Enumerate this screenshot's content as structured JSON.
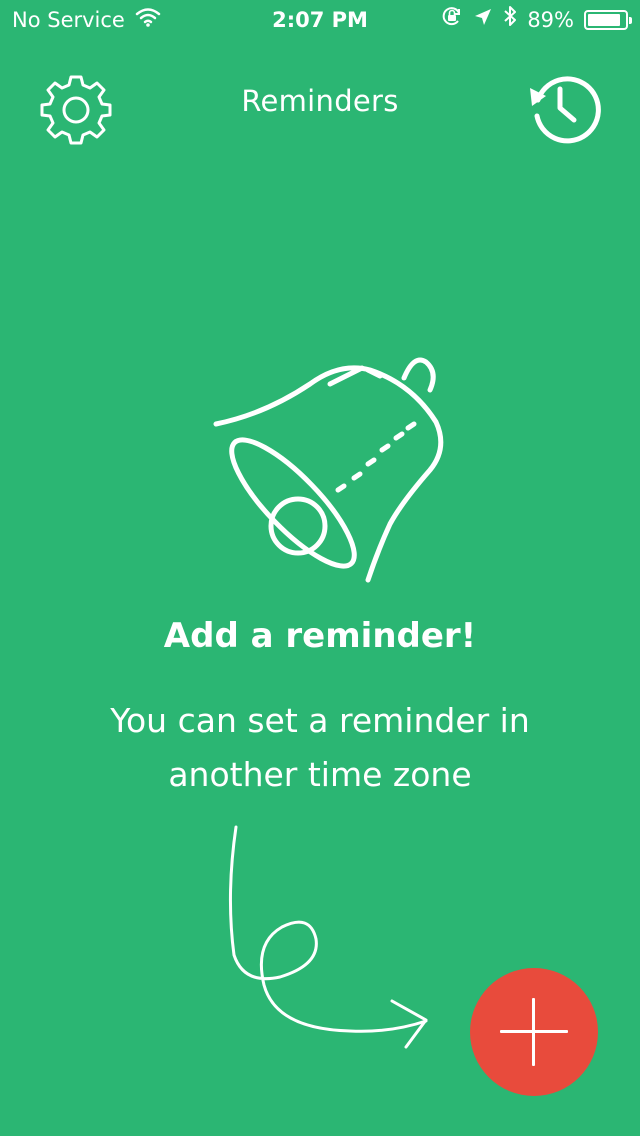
{
  "status_bar": {
    "carrier": "No Service",
    "time": "2:07 PM",
    "battery_percent": "89%",
    "battery_level": 0.89,
    "icons": [
      "wifi-icon",
      "orientation-lock-icon",
      "location-arrow-icon",
      "bluetooth-icon",
      "battery-icon"
    ]
  },
  "navbar": {
    "title": "Reminders",
    "left_icon": "gear-icon",
    "right_icon": "history-icon"
  },
  "empty_state": {
    "illustration": "bell-icon",
    "heading": "Add a reminder!",
    "subtext": "You can set a reminder in another time zone"
  },
  "fab": {
    "icon": "plus-icon",
    "color": "#E84B3C"
  },
  "colors": {
    "background": "#2BB673",
    "foreground": "#FFFFFF"
  }
}
